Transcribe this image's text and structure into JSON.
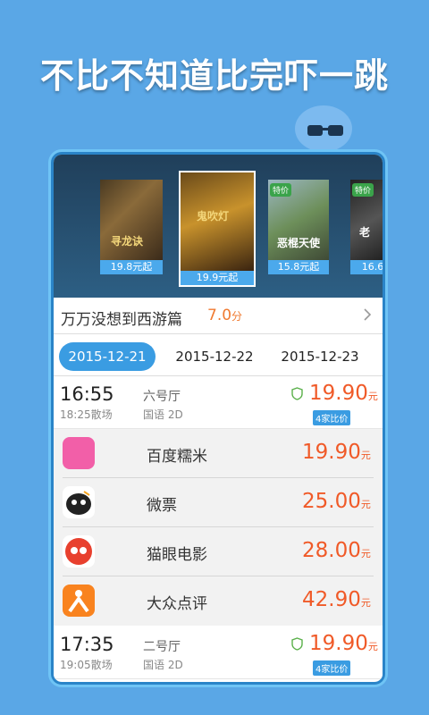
{
  "headline": "不比不知道比完吓一跳",
  "posters": [
    {
      "title": "寻龙诀",
      "price": "19.8元起"
    },
    {
      "title": "鬼吹灯",
      "price": "19.9元起"
    },
    {
      "title": "恶棍天使",
      "price": "15.8元起",
      "badge": "特价"
    },
    {
      "title": "老",
      "price": "16.6",
      "badge": "特价"
    }
  ],
  "movie": {
    "title": "万万没想到西游篇",
    "score": "7.0",
    "score_unit": "分"
  },
  "dates": [
    "2015-12-21",
    "2015-12-22",
    "2015-12-23"
  ],
  "active_date": 0,
  "shows": [
    {
      "time": "16:55",
      "end": "18:25散场",
      "hall": "六号厅",
      "lang": "国语 2D",
      "price": "19.90",
      "unit": "元",
      "compare": "4家比价"
    },
    {
      "time": "17:35",
      "end": "19:05散场",
      "hall": "二号厅",
      "lang": "国语 2D",
      "price": "19.90",
      "unit": "元",
      "compare": "4家比价"
    }
  ],
  "vendors": [
    {
      "name": "百度糯米",
      "price": "19.90",
      "unit": "元",
      "logo": "nuomi-icon",
      "color": "#f25fa8"
    },
    {
      "name": "微票",
      "price": "25.00",
      "unit": "元",
      "logo": "weipiao-icon",
      "color": "#ffffff"
    },
    {
      "name": "猫眼电影",
      "price": "28.00",
      "unit": "元",
      "logo": "maoyan-icon",
      "color": "#e8402e"
    },
    {
      "name": "大众点评",
      "price": "42.90",
      "unit": "元",
      "logo": "dianping-icon",
      "color": "#f9831f"
    }
  ]
}
